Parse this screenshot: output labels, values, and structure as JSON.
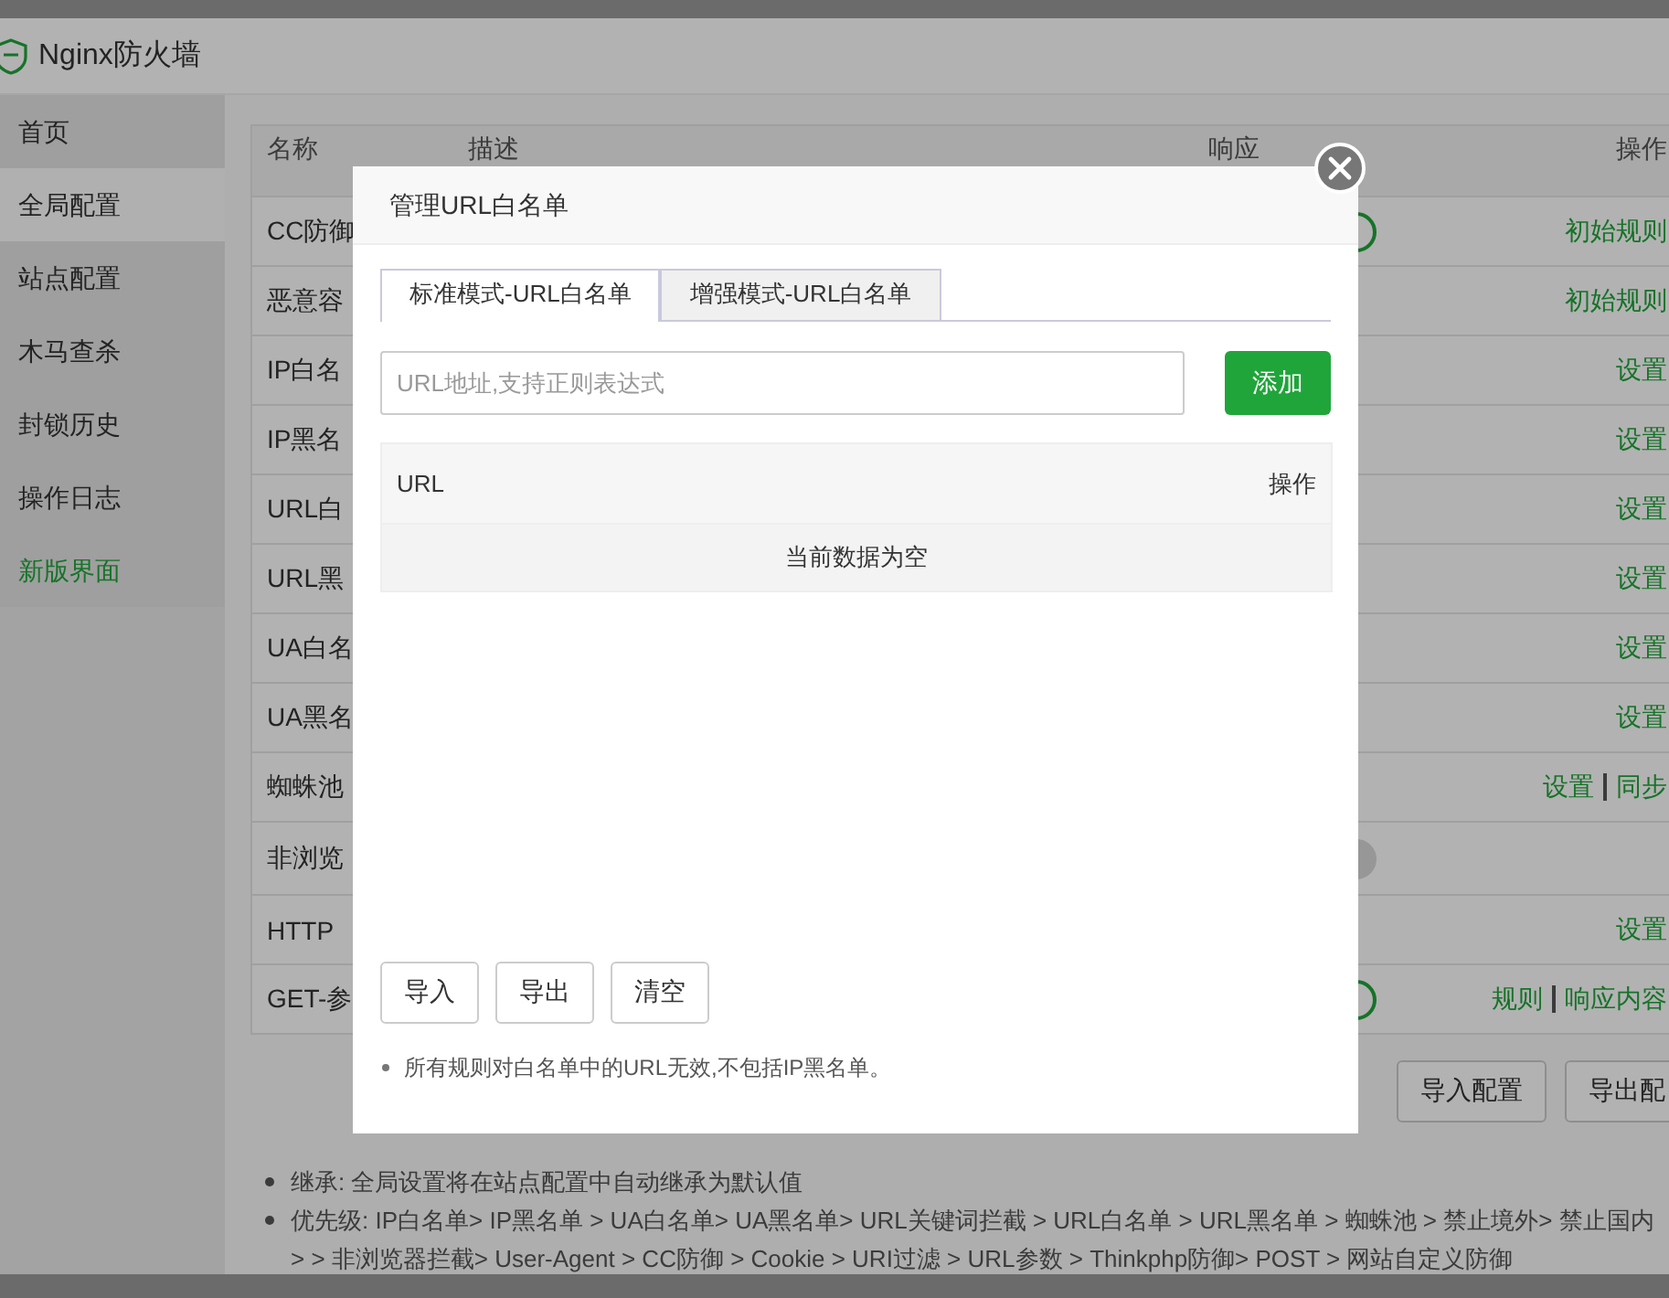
{
  "window": {
    "title": "Nginx防火墙"
  },
  "sidebar": {
    "items": [
      {
        "label": "首页",
        "selected": false,
        "kind": "page"
      },
      {
        "label": "全局配置",
        "selected": true,
        "kind": "page"
      },
      {
        "label": "站点配置",
        "selected": false,
        "kind": "page"
      },
      {
        "label": "木马查杀",
        "selected": false,
        "kind": "page"
      },
      {
        "label": "封锁历史",
        "selected": false,
        "kind": "page"
      },
      {
        "label": "操作日志",
        "selected": false,
        "kind": "page"
      },
      {
        "label": "新版界面",
        "selected": false,
        "kind": "link"
      }
    ]
  },
  "table": {
    "columns": [
      "名称",
      "描述",
      "响应",
      "操作"
    ],
    "rows": [
      {
        "name": "CC防御",
        "switch_on": true,
        "actions": [
          "初始规则"
        ]
      },
      {
        "name": "恶意容",
        "actions": [
          "初始规则"
        ]
      },
      {
        "name": "IP白名",
        "actions": [
          "设置"
        ]
      },
      {
        "name": "IP黑名",
        "actions": [
          "设置"
        ]
      },
      {
        "name": "URL白",
        "actions": [
          "设置"
        ]
      },
      {
        "name": "URL黑",
        "actions": [
          "设置"
        ]
      },
      {
        "name": "UA白名",
        "actions": [
          "设置"
        ]
      },
      {
        "name": "UA黑名",
        "actions": [
          "设置"
        ]
      },
      {
        "name": "蜘蛛池",
        "actions": [
          "设置",
          "同步"
        ]
      },
      {
        "name": "非浏览",
        "switch_on": false
      },
      {
        "name": "HTTP",
        "actions": [
          "设置"
        ]
      },
      {
        "name": "GET-参",
        "switch_on": true,
        "actions": [
          "规则",
          "响应内容"
        ]
      }
    ]
  },
  "footer_buttons": [
    "导入配置",
    "导出配"
  ],
  "notes": [
    "继承: 全局设置将在站点配置中自动继承为默认值",
    "优先级: IP白名单> IP黑名单 > UA白名单> UA黑名单> URL关键词拦截 > URL白名单 > URL黑名单 > 蜘蛛池 > 禁止境外> 禁止国内> > 非浏览器拦截> User-Agent > CC防御 > Cookie > URI过滤 > URL参数 > Thinkphp防御> POST > 网站自定义防御"
  ],
  "dialog": {
    "title": "管理URL白名单",
    "tabs": [
      {
        "label": "标准模式-URL白名单",
        "selected": true
      },
      {
        "label": "增强模式-URL白名单",
        "selected": false
      }
    ],
    "url_field": {
      "placeholder": "URL地址,支持正则表达式"
    },
    "add_button": "添加",
    "list": {
      "columns": [
        "URL",
        "操作"
      ],
      "empty_text": "当前数据为空"
    },
    "buttons": [
      "导入",
      "导出",
      "清空"
    ],
    "notes": [
      "所有规则对白名单中的URL无效,不包括IP黑名单。"
    ]
  }
}
